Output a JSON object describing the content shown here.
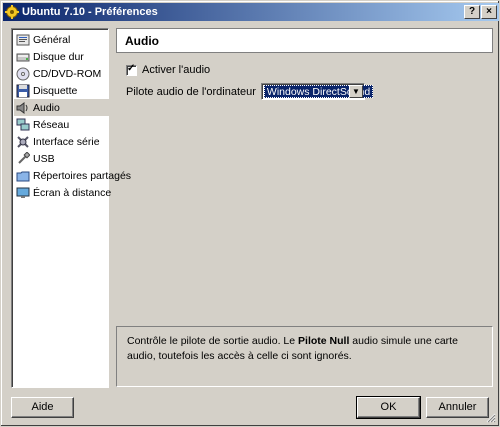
{
  "window": {
    "title": "Ubuntu 7.10 - Préférences",
    "help_button": "?",
    "close_button": "×"
  },
  "sidebar": {
    "items": [
      {
        "label": "Général",
        "icon": "general-icon"
      },
      {
        "label": "Disque dur",
        "icon": "hard-disk-icon"
      },
      {
        "label": "CD/DVD-ROM",
        "icon": "cd-dvd-icon"
      },
      {
        "label": "Disquette",
        "icon": "floppy-icon"
      },
      {
        "label": "Audio",
        "icon": "audio-icon",
        "selected": true
      },
      {
        "label": "Réseau",
        "icon": "network-icon"
      },
      {
        "label": "Interface série",
        "icon": "serial-port-icon"
      },
      {
        "label": "USB",
        "icon": "usb-icon"
      },
      {
        "label": "Répertoires partagés",
        "icon": "shared-folders-icon"
      },
      {
        "label": "Écran à distance",
        "icon": "remote-display-icon"
      }
    ]
  },
  "main": {
    "header_title": "Audio",
    "enable_audio": {
      "label": "Activer l'audio",
      "checked": true
    },
    "driver": {
      "label": "Pilote audio de l'ordinateur",
      "value": "Windows DirectSound"
    },
    "description": {
      "before": "Contrôle le pilote de sortie audio. Le ",
      "bold": "Pilote Null",
      "after": " audio simule une carte audio, toutefois les accès à celle ci sont ignorés."
    }
  },
  "buttons": {
    "help": "Aide",
    "ok": "OK",
    "cancel": "Annuler"
  }
}
